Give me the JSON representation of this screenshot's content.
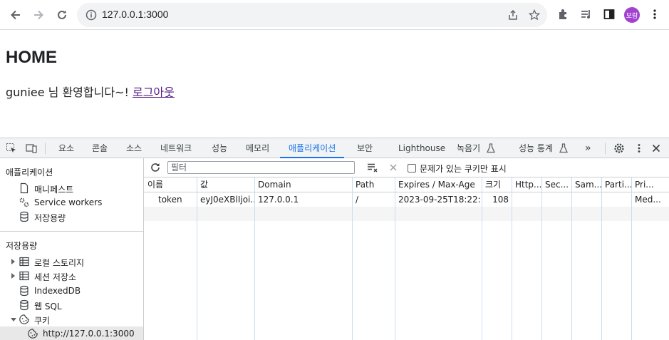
{
  "browser": {
    "url": "127.0.0.1:3000",
    "profile_initials": "보람"
  },
  "page": {
    "heading": "HOME",
    "welcome_text": "guniee 님 환영합니다~! ",
    "logout_link": "로그아웃"
  },
  "devtools": {
    "tabs": [
      "요소",
      "콘솔",
      "소스",
      "네트워크",
      "성능",
      "메모리",
      "애플리케이션",
      "보안",
      "Lighthouse",
      "녹음기",
      "성능 통계",
      "»"
    ],
    "active_tab": "애플리케이션",
    "sidebar": {
      "app_section": "애플리케이션",
      "app_items": [
        "매니페스트",
        "Service workers",
        "저장용량"
      ],
      "storage_section": "저장용량",
      "storage_items": [
        "로컬 스토리지",
        "세션 저장소",
        "IndexedDB",
        "웹 SQL",
        "쿠키"
      ],
      "cookie_origin": "http://127.0.0.1:3000"
    },
    "cookies": {
      "filter_placeholder": "필터",
      "only_issues_label": "문제가 있는 쿠키만 표시",
      "columns": [
        "이름",
        "값",
        "Domain",
        "Path",
        "Expires / Max-Age",
        "크기",
        "Http...",
        "Sec...",
        "Sam...",
        "Parti...",
        "Pri..."
      ],
      "rows": [
        {
          "name": "token",
          "value": "eyJ0eXBlIjoi...",
          "domain": "127.0.0.1",
          "path": "/",
          "expires": "2023-09-25T18:22:...",
          "size": "108",
          "http": "",
          "secure": "",
          "samesite": "",
          "partition": "",
          "priority": "Med..."
        }
      ]
    }
  },
  "colors": {
    "accent": "#1a73e8",
    "link_visited": "#551a8b",
    "avatar": "#a142d0"
  }
}
